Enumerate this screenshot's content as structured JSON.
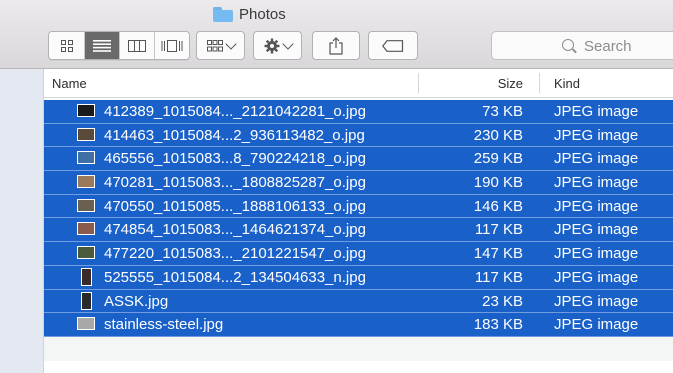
{
  "window": {
    "title": "Photos"
  },
  "toolbar": {
    "view_buttons": [
      "icon-view",
      "list-view",
      "column-view",
      "gallery-view"
    ],
    "active_view": "list-view",
    "group_icon": "grid-icon",
    "action_icon": "gear-icon",
    "share_icon": "share-icon",
    "tag_icon": "tag-icon"
  },
  "search": {
    "placeholder": "Search"
  },
  "columns": {
    "name": "Name",
    "size": "Size",
    "kind": "Kind"
  },
  "selection_color": "#1961c9",
  "files": [
    {
      "name": "412389_1015084..._2121042281_o.jpg",
      "size": "73 KB",
      "kind": "JPEG image",
      "thumb": "#1a1a1a",
      "orientation": "landscape"
    },
    {
      "name": "414463_1015084...2_936113482_o.jpg",
      "size": "230 KB",
      "kind": "JPEG image",
      "thumb": "#5a4a3a",
      "orientation": "landscape"
    },
    {
      "name": "465556_1015083...8_790224218_o.jpg",
      "size": "259 KB",
      "kind": "JPEG image",
      "thumb": "#3f6fa5",
      "orientation": "landscape"
    },
    {
      "name": "470281_1015083..._1808825287_o.jpg",
      "size": "190 KB",
      "kind": "JPEG image",
      "thumb": "#9a7a5a",
      "orientation": "landscape"
    },
    {
      "name": "470550_1015085..._1888106133_o.jpg",
      "size": "146 KB",
      "kind": "JPEG image",
      "thumb": "#6a6050",
      "orientation": "landscape"
    },
    {
      "name": "474854_1015083..._1464621374_o.jpg",
      "size": "117 KB",
      "kind": "JPEG image",
      "thumb": "#8a5a4a",
      "orientation": "landscape"
    },
    {
      "name": "477220_1015083..._2101221547_o.jpg",
      "size": "147 KB",
      "kind": "JPEG image",
      "thumb": "#4a5a3a",
      "orientation": "landscape"
    },
    {
      "name": "525555_1015084...2_134504633_n.jpg",
      "size": "117 KB",
      "kind": "JPEG image",
      "thumb": "#3a2a2a",
      "orientation": "portrait"
    },
    {
      "name": "ASSK.jpg",
      "size": "23 KB",
      "kind": "JPEG image",
      "thumb": "#2a2a2a",
      "orientation": "portrait"
    },
    {
      "name": "stainless-steel.jpg",
      "size": "183 KB",
      "kind": "JPEG image",
      "thumb": "#a8a8a8",
      "orientation": "landscape"
    }
  ]
}
